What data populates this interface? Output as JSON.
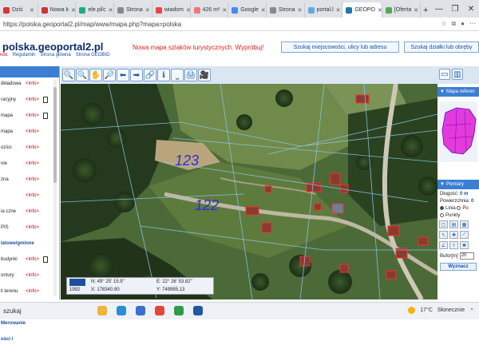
{
  "browser": {
    "tabs": [
      {
        "label": "Dziś",
        "color": "#d33",
        "active": false
      },
      {
        "label": "Nowa k",
        "color": "#c33",
        "active": false
      },
      {
        "label": "ele.pl/c",
        "color": "#2a8",
        "active": false
      },
      {
        "label": "Strona",
        "color": "#888",
        "active": false
      },
      {
        "label": "wiadom",
        "color": "#e44",
        "active": false
      },
      {
        "label": "426 m²",
        "color": "#e77",
        "active": false
      },
      {
        "label": "Google",
        "color": "#48f",
        "active": false
      },
      {
        "label": "Strona",
        "color": "#888",
        "active": false
      },
      {
        "label": "portal.l",
        "color": "#6ad",
        "active": false
      },
      {
        "label": "GEOPO",
        "color": "#27a",
        "active": true
      },
      {
        "label": "[Oferta",
        "color": "#5a5",
        "active": false
      }
    ],
    "new_tab": "+",
    "url": "https://polska.geoportal2.pl/map/www/mapa.php?mapa=polska",
    "window_controls": [
      "—",
      "❐",
      "✕"
    ]
  },
  "site": {
    "logo": "polska.geoportal2.pl",
    "nav": [
      "noc",
      "Regulamin",
      "Strona główna",
      "Strona GEOBID"
    ],
    "promo": "Nowa mapa szlaków turystycznych. Wypróbuj!",
    "search_address_btn": "Szukaj miejscowości, ulicy lub adresu",
    "search_parcel_btn": "Szukaj działki lub obręby"
  },
  "layers": [
    {
      "name": "dkładowa",
      "info": "<Info>",
      "icon": false
    },
    {
      "name": "racyjny",
      "info": "<Info>",
      "icon": true
    },
    {
      "name": "mapa",
      "info": "<Info>",
      "icon": true
    },
    {
      "name": "mapa",
      "info": "<Info>",
      "icon": false
    },
    {
      "name": "ozści",
      "info": "<Info>",
      "icon": false
    },
    {
      "name": "nie",
      "info": "<Info>",
      "icon": false
    },
    {
      "name": "zna",
      "info": "<Info>",
      "icon": false
    },
    {
      "name": "",
      "info": "<Info>",
      "icon": false
    },
    {
      "name": "ia czne",
      "info": "<Info>",
      "icon": false
    },
    {
      "name": "PIS",
      "info": "<Info>",
      "icon": false
    },
    {
      "name": "latowe/gminne",
      "info": "",
      "icon": false,
      "blue": true
    },
    {
      "name": "budynki",
      "info": "<Info>",
      "icon": true
    },
    {
      "name": "ontury",
      "info": "<Info>",
      "icon": false
    },
    {
      "name": "li terenu",
      "info": "<Info>",
      "icon": false
    },
    {
      "name": "resy",
      "info": "<Info>",
      "icon": false
    },
    {
      "name": "Merowanie",
      "info": "",
      "icon": false,
      "blue": true
    },
    {
      "name": "ości i",
      "info": "",
      "icon": false,
      "blue": true
    }
  ],
  "map": {
    "toolbar_icons": [
      "zoom-in",
      "zoom-out",
      "pan",
      "zoom-box",
      "back",
      "forward",
      "link",
      "info",
      "measure",
      "print",
      "camera"
    ],
    "toolbar_glyphs": [
      "🔍",
      "🔍",
      "✋",
      "🔎",
      "⬅",
      "➡",
      "🔗",
      "ℹ",
      "⎵",
      "🖨",
      "🎥"
    ],
    "parcel_labels": [
      "123",
      "122"
    ],
    "coords": {
      "year": "1992",
      "n": "N:  49° 25' 15.9\"",
      "x": "X:  178340.90",
      "e": "E:  22° 26' 53.82\"",
      "y": "Y:  749985.13"
    }
  },
  "right_panel": {
    "ref_map_title": "Mapa referen",
    "pomiary_title": "Pomiary",
    "dlugosc_label": "Długość:",
    "dlugosc_value": "0 m",
    "powierzchnia_label": "Powierzchnia:",
    "powierzchnia_value": "0",
    "modes": [
      "Linia",
      "Po",
      "Punkty"
    ],
    "bufor_label": "Bufor[m]",
    "bufor_value": "20",
    "wyznacz": "Wyznacz"
  },
  "taskbar": {
    "search": "szukaj",
    "temp": "17°C",
    "weather": "Słonecznie"
  },
  "colors": {
    "accent": "#3b7fd3",
    "link": "#1a4fa0",
    "info_red": "#cc0000",
    "parcel_label": "#2b2ed8"
  }
}
